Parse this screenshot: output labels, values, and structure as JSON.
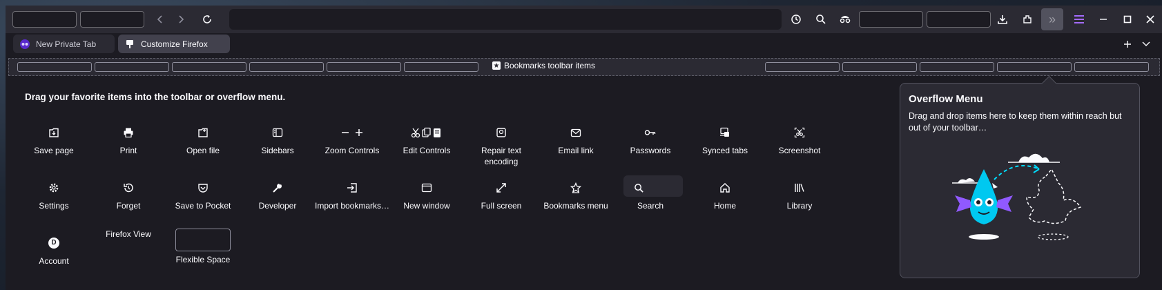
{
  "tabs": [
    {
      "label": "New Private Tab",
      "icon": "private-mask-icon"
    },
    {
      "label": "Customize Firefox",
      "icon": "puzzle-piece-icon"
    }
  ],
  "bookmarks_toolbar": {
    "label": "Bookmarks toolbar items"
  },
  "palette": {
    "title": "Drag your favorite items into the toolbar or overflow menu.",
    "items": [
      {
        "label": "Save page",
        "icon": "save-page-icon"
      },
      {
        "label": "Print",
        "icon": "print-icon"
      },
      {
        "label": "Open file",
        "icon": "open-file-icon"
      },
      {
        "label": "Sidebars",
        "icon": "sidebars-icon"
      },
      {
        "label": "Zoom Controls",
        "icon": "zoom-icon"
      },
      {
        "label": "Edit Controls",
        "icon": "edit-icon"
      },
      {
        "label": "Repair text encoding",
        "icon": "text-encoding-icon"
      },
      {
        "label": "Email link",
        "icon": "email-icon"
      },
      {
        "label": "Passwords",
        "icon": "key-icon"
      },
      {
        "label": "Synced tabs",
        "icon": "synced-tabs-icon"
      },
      {
        "label": "Screenshot",
        "icon": "screenshot-icon"
      },
      {
        "label": "Settings",
        "icon": "gear-icon"
      },
      {
        "label": "Forget",
        "icon": "forget-icon"
      },
      {
        "label": "Save to Pocket",
        "icon": "pocket-icon"
      },
      {
        "label": "Developer",
        "icon": "wrench-icon"
      },
      {
        "label": "Import bookmarks…",
        "icon": "import-icon"
      },
      {
        "label": "New window",
        "icon": "new-window-icon"
      },
      {
        "label": "Full screen",
        "icon": "fullscreen-icon"
      },
      {
        "label": "Bookmarks menu",
        "icon": "bookmarks-menu-icon"
      },
      {
        "label": "Search",
        "icon": "search-icon"
      },
      {
        "label": "Home",
        "icon": "home-icon"
      },
      {
        "label": "Library",
        "icon": "library-icon"
      },
      {
        "label": "Account",
        "icon": "account-icon"
      },
      {
        "label": "Firefox View",
        "icon": ""
      },
      {
        "label": "Flexible Space",
        "icon": ""
      }
    ]
  },
  "overflow_menu": {
    "title": "Overflow Menu",
    "description": "Drag and drop items here to keep them within reach but out of your toolbar…"
  },
  "avatar_letter": "D"
}
